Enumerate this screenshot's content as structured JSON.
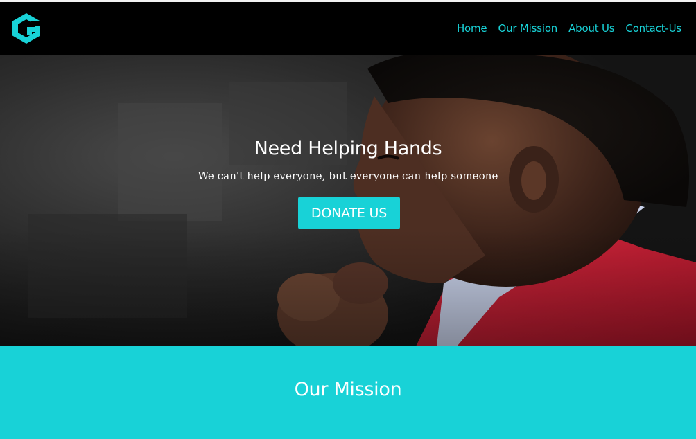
{
  "brand": {
    "logo_icon": "g-hexagon-logo-icon",
    "accent_color": "#18d2d7"
  },
  "nav": {
    "items": [
      {
        "label": "Home"
      },
      {
        "label": "Our Mission"
      },
      {
        "label": "About Us"
      },
      {
        "label": "Contact-Us"
      }
    ]
  },
  "hero": {
    "title": "Need Helping Hands",
    "subtitle": "We can't help everyone, but everyone can help someone",
    "cta_label": "DONATE US"
  },
  "mission": {
    "title": "Our Mission"
  }
}
